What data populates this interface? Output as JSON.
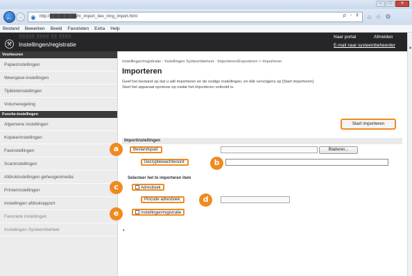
{
  "browser": {
    "url": "http://█████████/m_import_dev_mng_import.html",
    "url_tools": "ρ - ¢",
    "menu": [
      "Bestand",
      "Bewerken",
      "Beeld",
      "Favorieten",
      "Extra",
      "Help"
    ]
  },
  "header": {
    "title": "Instellingen/registratie",
    "device_name_blurred": "▒▒▒▒▒  ▒▒▒▒  ▒▒ ▒▒▒▒",
    "portal_link": "Naar portal",
    "logout_link": "Afmelden",
    "email_link": "E-mail naar systeembeheerder"
  },
  "sidebar": {
    "section_prefs": "Voorkeuren",
    "prefs_items": [
      "Papierinstellingen",
      "Weergave-instellingen",
      "Tijdklokinstellingen",
      "Volumeregeling"
    ],
    "section_functions": "Functie-instellingen",
    "function_items": [
      "Algemene instellingen",
      "Kopieerinstellingen",
      "Faxinstellingen",
      "Scaninstellingen",
      "Afdrukinstellingen geheugenmedia",
      "Printerinstellingen",
      "Instellingen afdrukrapport",
      "Favoriete instellingen",
      "Instellingen Systeembeheer"
    ]
  },
  "main": {
    "breadcrumb": "Instellingen/registratie : Instellingen Systeembeheer : Importeren/Exporteren > Importeren",
    "title": "Importeren",
    "description_line1": "Geef het bestand op dat u wilt importeren en de nodige instellingen, en klik vervolgens op [Start importeren].",
    "description_line2": "Start het apparaat opnieuw op nadat het importeren voltooid is.",
    "start_button": "Start importeren",
    "section_import": "Importinstellingen",
    "file_label": "Bestandspad:",
    "browse_button": "Bladeren...",
    "decrypt_label": "Decryptiewachtwoord:",
    "section_select": "Selecteer het te importeren item",
    "addressbook_label": "Adresboek",
    "pin_label": "Pincode adresboek:",
    "settings_label": "Instellingen/registratie"
  },
  "markers": {
    "a": "a",
    "b": "b",
    "c": "c",
    "d": "d",
    "e": "e"
  },
  "colors": {
    "accent": "#f08a1f",
    "header": "#262628",
    "sidebar": "#ececec"
  }
}
